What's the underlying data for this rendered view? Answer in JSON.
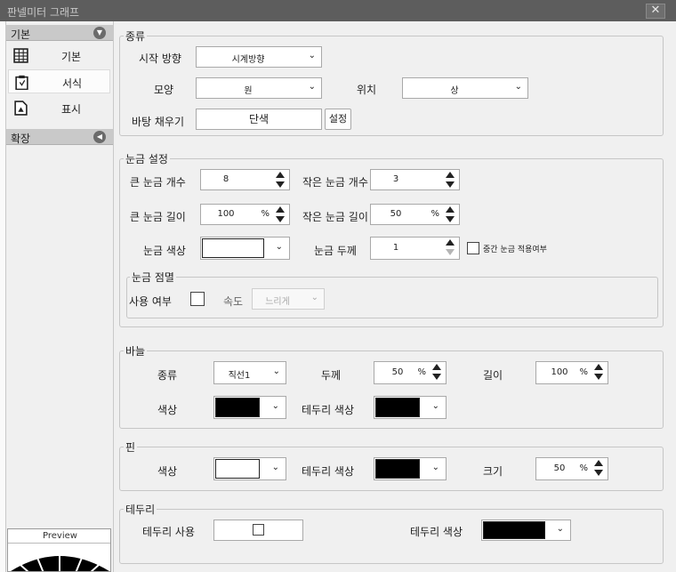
{
  "window": {
    "title": "판넬미터 그래프",
    "close": "✕"
  },
  "sidebar": {
    "group_basic": "기본",
    "items": [
      {
        "label": "기본",
        "icon": "grid-icon"
      },
      {
        "label": "서식",
        "icon": "clipboard-icon"
      },
      {
        "label": "표시",
        "icon": "document-icon"
      }
    ],
    "group_ext": "확장",
    "preview_label": "Preview"
  },
  "type": {
    "title": "종류",
    "start_dir_label": "시작 방향",
    "start_dir_value": "시계방향",
    "shape_label": "모양",
    "shape_value": "원",
    "position_label": "위치",
    "position_value": "상",
    "fill_label": "바탕 채우기",
    "fill_value": "단색",
    "fill_button": "설정"
  },
  "ticks": {
    "title": "눈금 설정",
    "major_count_label": "큰 눈금 개수",
    "major_count": "8",
    "minor_count_label": "작은 눈금 개수",
    "minor_count": "3",
    "major_len_label": "큰 눈금 길이",
    "major_len": "100",
    "major_len_unit": "%",
    "minor_len_label": "작은 눈금 길이",
    "minor_len": "50",
    "minor_len_unit": "%",
    "color_label": "눈금 색상",
    "color": "#ffffff",
    "thickness_label": "눈금 두께",
    "thickness": "1",
    "mid_label": "중간 눈금 적용여부",
    "blink": {
      "title": "눈금 점멸",
      "use_label": "사용 여부",
      "speed_label": "속도",
      "speed_value": "느리게"
    }
  },
  "needle": {
    "title": "바늘",
    "type_label": "종류",
    "type_value": "직선1",
    "thickness_label": "두께",
    "thickness": "50",
    "thickness_unit": "%",
    "length_label": "길이",
    "length": "100",
    "length_unit": "%",
    "color_label": "색상",
    "color": "#000000",
    "border_color_label": "테두리 색상",
    "border_color": "#000000"
  },
  "pin": {
    "title": "핀",
    "color_label": "색상",
    "color": "#ffffff",
    "border_color_label": "테두리 색상",
    "border_color": "#000000",
    "size_label": "크기",
    "size": "50",
    "size_unit": "%"
  },
  "border": {
    "title": "테두리",
    "use_label": "테두리 사용",
    "color_label": "테두리 색상",
    "color": "#000000"
  }
}
